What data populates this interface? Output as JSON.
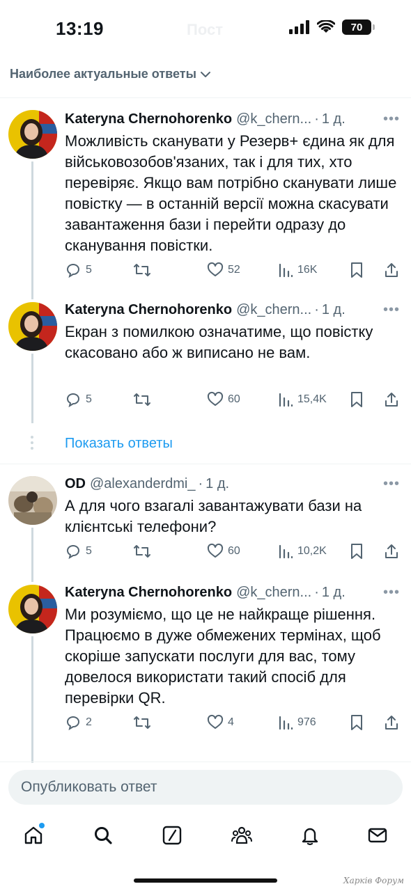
{
  "status_bar": {
    "time": "13:19",
    "ghost_title": "Пост",
    "battery": "70"
  },
  "sort": {
    "label": "Наиболее актуальные ответы"
  },
  "tweets": [
    {
      "name": "Kateryna Chernohorenko",
      "handle": "@k_chern...",
      "time": "1 д.",
      "text": "Можливість сканувати у Резерв+ єдина як для військовозобов'язаних, так і для тих, хто перевіряє. Якщо вам потрібно сканувати лише повістку — в останній версії можна скасувати завантаження бази і перейти одразу до сканування повістки.",
      "replies": "5",
      "likes": "52",
      "views": "16K"
    },
    {
      "name": "Kateryna Chernohorenko",
      "handle": "@k_chern...",
      "time": "1 д.",
      "text": "Екран з помилкою означатиме, що повістку скасовано або ж виписано не вам.",
      "replies": "5",
      "likes": "60",
      "views": "15,4K"
    },
    {
      "name": "OD",
      "handle": "@alexanderdmi_",
      "time": "1 д.",
      "text": "А для чого взагалі завантажувати бази на клієнтські телефони?",
      "replies": "5",
      "likes": "60",
      "views": "10,2K"
    },
    {
      "name": "Kateryna Chernohorenko",
      "handle": "@k_chern...",
      "time": "1 д.",
      "text": "Ми розуміємо, що це не найкраще рішення. Працюємо в дуже обмежених термінах, щоб скоріше запускати послуги для вас, тому довелося використати такий спосіб для перевірки QR.",
      "replies": "2",
      "likes": "4",
      "views": "976"
    }
  ],
  "show_replies": "Показать ответы",
  "composer": {
    "placeholder": "Опубликовать ответ"
  },
  "tabbar": {
    "items": [
      "home-icon",
      "search-icon",
      "grok-icon",
      "communities-icon",
      "notifications-icon",
      "messages-icon"
    ]
  },
  "watermark": "Харків Форум",
  "colors": {
    "accent": "#1d9bf0",
    "muted": "#536471",
    "text": "#0f1419",
    "line": "#cfd9de"
  }
}
